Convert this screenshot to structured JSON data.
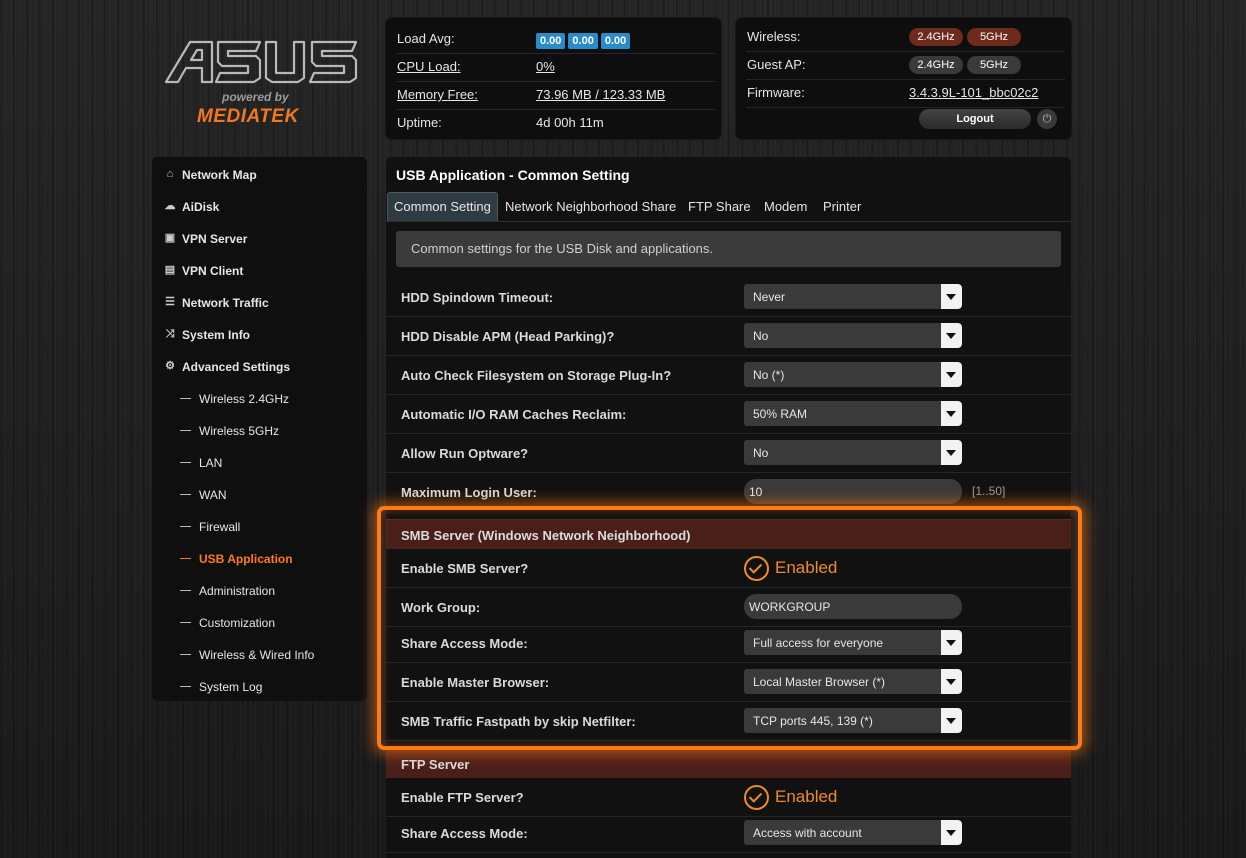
{
  "logo": {
    "powered_by": "powered by",
    "brand": "MEDIATEK"
  },
  "status": {
    "load_avg_label": "Load Avg:",
    "load_avg_values": [
      "0.00",
      "0.00",
      "0.00"
    ],
    "cpu_label": "CPU Load:",
    "cpu_value": "0%",
    "memory_label": "Memory Free:",
    "memory_value": "73.96 MB / 123.33 MB",
    "uptime_label": "Uptime:",
    "uptime_value": "4d 00h 11m",
    "wireless_label": "Wireless:",
    "wireless_bands": [
      "2.4GHz",
      "5GHz"
    ],
    "guest_label": "Guest AP:",
    "guest_bands": [
      "2.4GHz",
      "5GHz"
    ],
    "firmware_label": "Firmware:",
    "firmware_value": "3.4.3.9L-101_bbc02c2",
    "logout_label": "Logout"
  },
  "sidebar": {
    "items": [
      {
        "label": "Network Map",
        "icon": "home-icon"
      },
      {
        "label": "AiDisk",
        "icon": "cloud-icon"
      },
      {
        "label": "VPN Server",
        "icon": "vpn-server-icon"
      },
      {
        "label": "VPN Client",
        "icon": "vpn-client-icon"
      },
      {
        "label": "Network Traffic",
        "icon": "traffic-icon"
      },
      {
        "label": "System Info",
        "icon": "shuffle-icon"
      },
      {
        "label": "Advanced Settings",
        "icon": "gear-icon"
      }
    ],
    "subitems": [
      {
        "label": "Wireless 2.4GHz"
      },
      {
        "label": "Wireless 5GHz"
      },
      {
        "label": "LAN"
      },
      {
        "label": "WAN"
      },
      {
        "label": "Firewall"
      },
      {
        "label": "USB Application"
      },
      {
        "label": "Administration"
      },
      {
        "label": "Customization"
      },
      {
        "label": "Wireless & Wired Info"
      },
      {
        "label": "System Log"
      }
    ],
    "active_color": "#ff7a1a"
  },
  "main": {
    "title": "USB Application - Common Setting",
    "tabs": [
      {
        "label": "Common Setting"
      },
      {
        "label": "Network Neighborhood Share"
      },
      {
        "label": "FTP Share"
      },
      {
        "label": "Modem"
      },
      {
        "label": "Printer"
      }
    ],
    "description": "Common settings for the USB Disk and applications.",
    "general": {
      "hdd_spindown_label": "HDD Spindown Timeout:",
      "hdd_spindown_value": "Never",
      "hdd_apm_label": "HDD Disable APM (Head Parking)?",
      "hdd_apm_value": "No",
      "auto_check_label": "Auto Check Filesystem on Storage Plug-In?",
      "auto_check_value": "No (*)",
      "io_cache_label": "Automatic I/O RAM Caches Reclaim:",
      "io_cache_value": "50% RAM",
      "optware_label": "Allow Run Optware?",
      "optware_value": "No",
      "max_login_label": "Maximum Login User:",
      "max_login_value": "10",
      "max_login_hint": "[1..50]"
    },
    "smb": {
      "section_title": "SMB Server (Windows Network Neighborhood)",
      "enable_label": "Enable SMB Server?",
      "enable_value": "Enabled",
      "workgroup_label": "Work Group:",
      "workgroup_value": "WORKGROUP",
      "access_label": "Share Access Mode:",
      "access_value": "Full access for everyone",
      "master_label": "Enable Master Browser:",
      "master_value": "Local Master Browser (*)",
      "fastpath_label": "SMB Traffic Fastpath by skip Netfilter:",
      "fastpath_value": "TCP ports 445, 139 (*)"
    },
    "ftp": {
      "section_title": "FTP Server",
      "enable_label": "Enable FTP Server?",
      "enable_value": "Enabled",
      "access_label": "Share Access Mode:",
      "access_value": "Access with account"
    }
  },
  "colors": {
    "accent_orange": "#ff7a12",
    "section_header": "#4a1f1a",
    "badge_blue": "#2a8bc9",
    "band_on": "#6e2a1c",
    "band_off": "#3a3a3a"
  }
}
